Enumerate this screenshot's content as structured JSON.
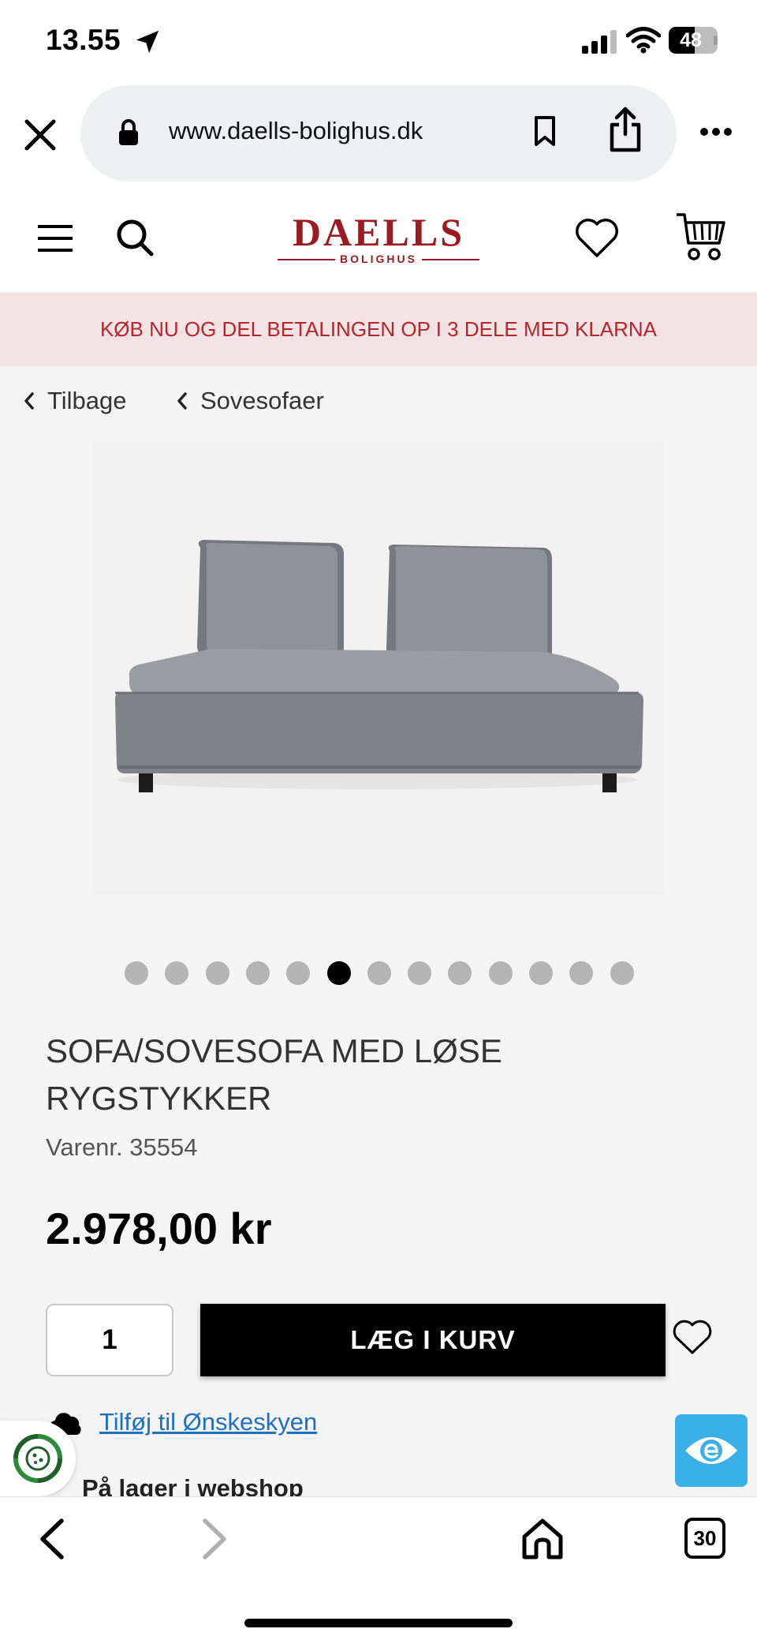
{
  "status_bar": {
    "time": "13.55",
    "battery": "48",
    "battery_level": 0.48
  },
  "browser": {
    "url": "www.daells-bolighus.dk",
    "tab_count": "30"
  },
  "site": {
    "logo_main": "DAELLS",
    "logo_sub": "BOLIGHUS"
  },
  "promo": {
    "text": "KØB NU OG DEL BETALINGEN OP I 3 DELE MED KLARNA"
  },
  "breadcrumb": {
    "back_label": "Tilbage",
    "category_label": "Sovesofaer"
  },
  "carousel": {
    "count": 13,
    "active_index": 5
  },
  "product": {
    "title": "SOFA/SOVESOFA MED LØSE RYGSTYKKER",
    "sku": "Varenr. 35554",
    "price": "2.978,00 kr",
    "quantity": "1",
    "add_to_cart_label": "LÆG I KURV",
    "wishlist_link": "Tilføj til Ønskeskyen",
    "stock_text": "På lager i webshop"
  },
  "colors": {
    "brand": "#9c1b22",
    "promo_bg": "#f3e3e4",
    "promo_text": "#b4262d",
    "link": "#1f6fc4",
    "widget": "#3bb0e6"
  },
  "icons": [
    "location-arrow-icon",
    "signal-icon",
    "wifi-icon",
    "battery-icon",
    "close-icon",
    "lock-icon",
    "bookmark-icon",
    "share-icon",
    "more-icon",
    "menu-icon",
    "search-icon",
    "heart-icon",
    "cart-icon",
    "chevron-left-icon",
    "cloud-icon",
    "cookie-icon",
    "eye-icon",
    "back-icon",
    "forward-icon",
    "home-icon",
    "tabs-icon"
  ]
}
